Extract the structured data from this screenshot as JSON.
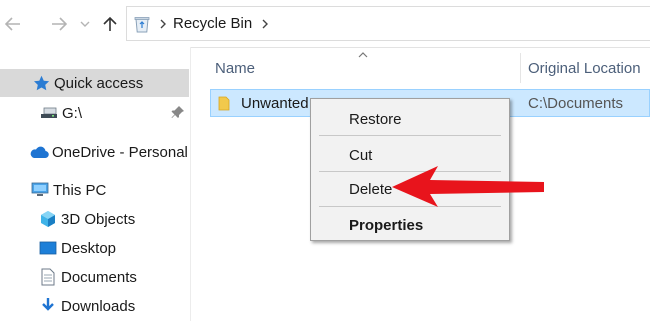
{
  "address_bar": {
    "path": "Recycle Bin"
  },
  "nav_pane": {
    "items": [
      {
        "label": "Quick access",
        "icon": "star-icon"
      },
      {
        "label": "G:\\",
        "icon": "drive-icon"
      },
      {
        "label": "OneDrive - Personal",
        "icon": "cloud-icon"
      },
      {
        "label": "This PC",
        "icon": "computer-icon"
      },
      {
        "label": "3D Objects",
        "icon": "cube-icon"
      },
      {
        "label": "Desktop",
        "icon": "desktop-icon"
      },
      {
        "label": "Documents",
        "icon": "document-icon"
      },
      {
        "label": "Downloads",
        "icon": "download-icon"
      }
    ]
  },
  "columns": {
    "name": "Name",
    "original_location": "Original Location"
  },
  "files": [
    {
      "name": "Unwanted",
      "original_location": "C:\\Documents"
    }
  ],
  "context_menu": {
    "items": [
      "Restore",
      "Cut",
      "Delete",
      "Properties"
    ]
  },
  "colors": {
    "selection_bg": "#cce8ff",
    "selection_border": "#99d1ff",
    "nav_selected_bg": "#d9d9d9",
    "annotation_arrow": "#e8141c",
    "star_blue": "#2b7cd3"
  }
}
